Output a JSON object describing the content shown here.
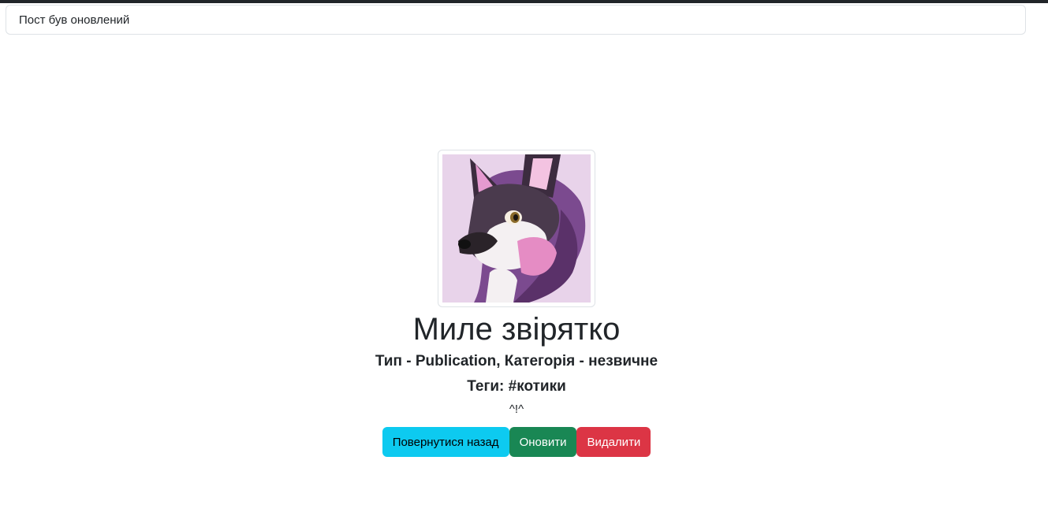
{
  "alert": {
    "message": "Пост був оновлений"
  },
  "post": {
    "title": "Миле звірятко",
    "meta": "Тип - Publication, Категорія - незвичне",
    "tags": "Теги: #котики",
    "description": "^!^"
  },
  "actions": {
    "back_label": "Повернутися назад",
    "update_label": "Оновити",
    "delete_label": "Видалити"
  },
  "colors": {
    "info": "#0dcaf0",
    "success": "#198754",
    "danger": "#dc3545",
    "border": "#dee2e6",
    "text": "#212529"
  }
}
